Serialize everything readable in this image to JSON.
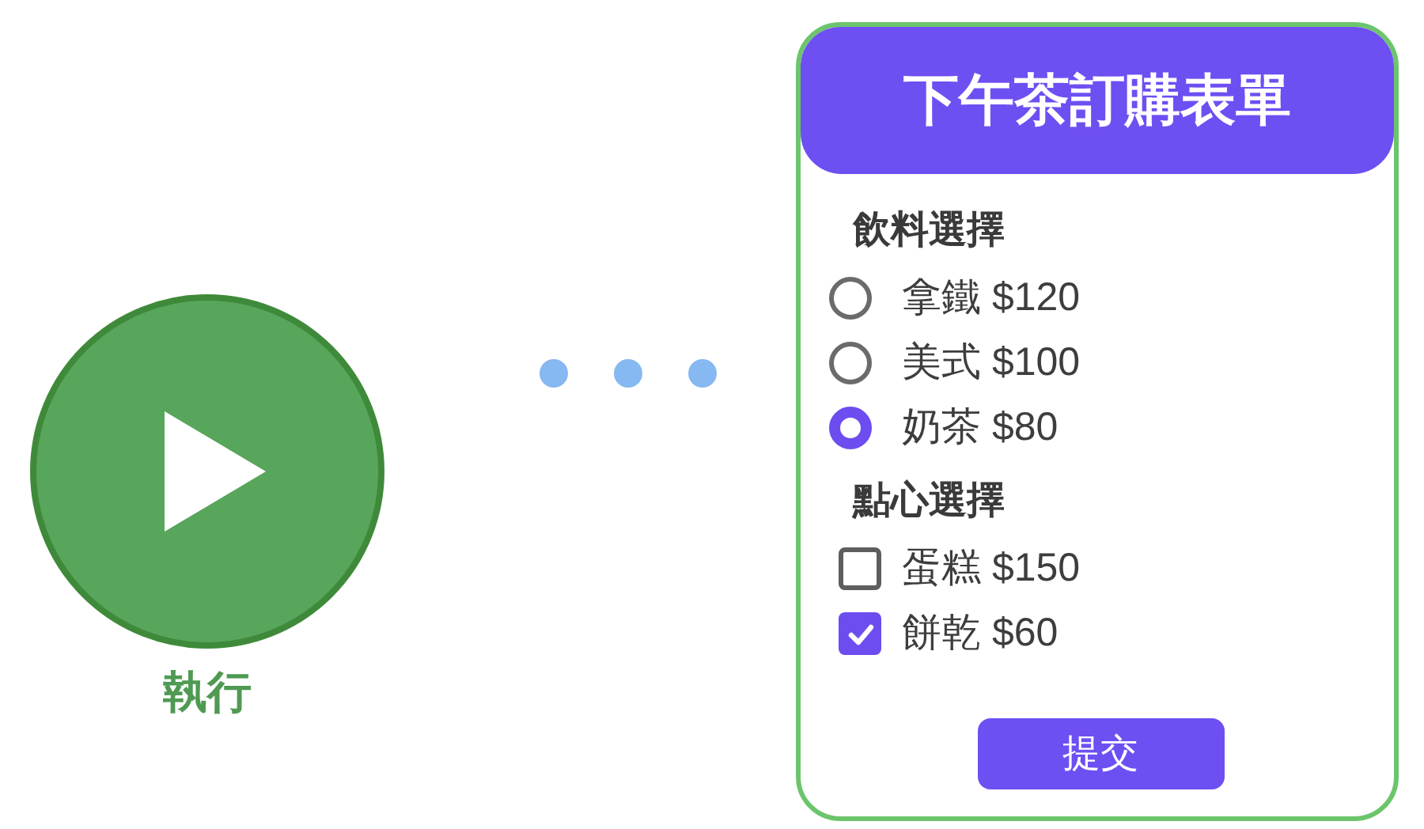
{
  "run": {
    "label": "執行"
  },
  "form": {
    "title": "下午茶訂購表單",
    "sections": [
      {
        "heading": "飲料選擇",
        "kind": "radio",
        "options": [
          {
            "label": "拿鐵 $120",
            "selected": false
          },
          {
            "label": "美式 $100",
            "selected": false
          },
          {
            "label": "奶茶 $80",
            "selected": true
          }
        ]
      },
      {
        "heading": "點心選擇",
        "kind": "checkbox",
        "options": [
          {
            "label": "蛋糕 $150",
            "checked": false
          },
          {
            "label": "餅乾 $60",
            "checked": true
          }
        ]
      }
    ],
    "submit": "提交"
  }
}
